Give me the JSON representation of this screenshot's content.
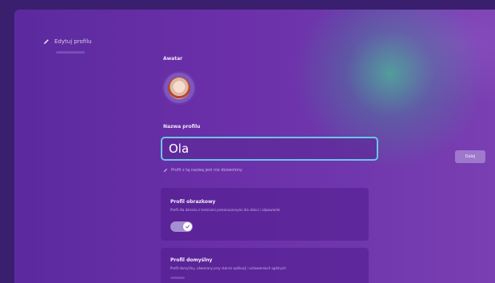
{
  "sidebar": {
    "items": [
      {
        "label": "Edytuj profilu",
        "icon": "pencil-icon"
      }
    ]
  },
  "profile": {
    "avatar_label": "Awatar",
    "name_label": "Nazwa profilu",
    "name_value": "Ola",
    "name_hint": "Profil z tą nazwą jest nie dozwolony"
  },
  "side_button": {
    "label": "Dalej"
  },
  "cards": [
    {
      "title": "Profil obrazkowy",
      "description": "Profil dla dziecka z treściami przeznaczonymi dla dzieci i odpowiedni",
      "toggle_on": true
    },
    {
      "title": "Profil domyślny",
      "description": "Profil domyślny, otwierany przy starcie aplikacji i ustawieniach ogólnych"
    }
  ],
  "colors": {
    "accent_focus": "#6cc6e6",
    "background": "#6a2fa8",
    "toggle_on": "#a48fd0"
  }
}
